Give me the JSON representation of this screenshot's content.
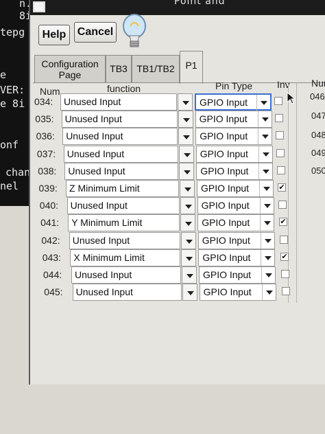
{
  "terminal": {
    "lines": [
      "n.",
      "8i",
      "tepg",
      "e",
      "VER:",
      "e  8i",
      "onf",
      "chang",
      "nel"
    ]
  },
  "window": {
    "title_partial": "Point and",
    "help_label": "Help",
    "cancel_label": "Cancel"
  },
  "tabs": [
    {
      "label": "Configuration",
      "label2": "Page"
    },
    {
      "label": "TB3"
    },
    {
      "label": "TB1/TB2"
    },
    {
      "label": "P1"
    }
  ],
  "headers": {
    "num": "Num",
    "function": "function",
    "pin_type": "Pin Type",
    "inv": "Inv",
    "num2": "Nur"
  },
  "rows": [
    {
      "num": "034:",
      "function": "Unused Input",
      "pin_type": "GPIO Input",
      "inv": ""
    },
    {
      "num": "035:",
      "function": "Unused Input",
      "pin_type": "GPIO Input",
      "inv": ""
    },
    {
      "num": "036:",
      "function": "Unused Input",
      "pin_type": "GPIO Input",
      "inv": ""
    },
    {
      "num": "037:",
      "function": "Unused Input",
      "pin_type": "GPIO Input",
      "inv": ""
    },
    {
      "num": "038:",
      "function": "Unused Input",
      "pin_type": "GPIO Input",
      "inv": ""
    },
    {
      "num": "039:",
      "function": "Z Minimum Limit",
      "pin_type": "GPIO Input",
      "inv": "✔"
    },
    {
      "num": "040:",
      "function": "Unused Input",
      "pin_type": "GPIO Input",
      "inv": ""
    },
    {
      "num": "041:",
      "function": "Y Minimum Limit",
      "pin_type": "GPIO Input",
      "inv": "✔"
    },
    {
      "num": "042:",
      "function": "Unused Input",
      "pin_type": "GPIO Input",
      "inv": ""
    },
    {
      "num": "043:",
      "function": "X Minimum Limit",
      "pin_type": "GPIO Input",
      "inv": "✔"
    },
    {
      "num": "044:",
      "function": "Unused Input",
      "pin_type": "GPIO Input",
      "inv": ""
    },
    {
      "num": "045:",
      "function": "Unused Input",
      "pin_type": "GPIO Input",
      "inv": ""
    }
  ],
  "side_numbers": [
    "046",
    "047",
    "048",
    "049",
    "050"
  ]
}
